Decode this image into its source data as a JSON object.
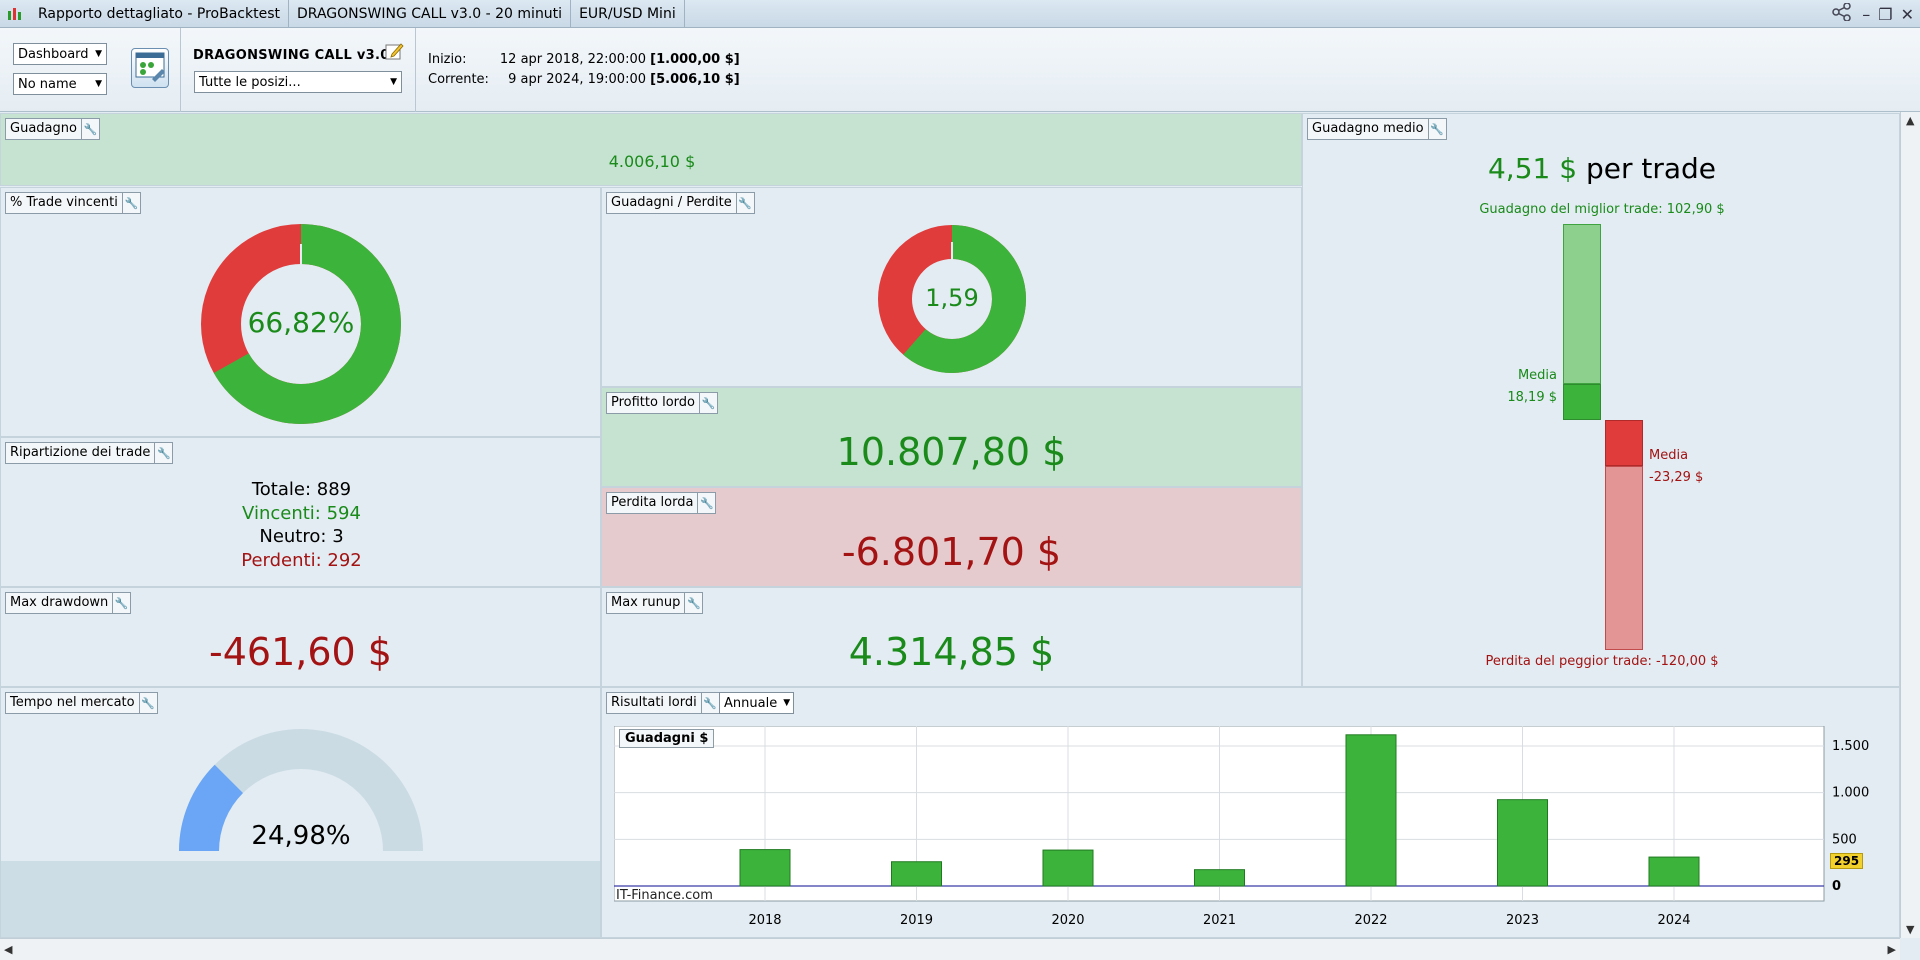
{
  "titlebar": {
    "tabs": [
      "Rapporto dettagliato - ProBacktest",
      "DRAGONSWING CALL v3.0 - 20 minuti",
      "EUR/USD Mini"
    ]
  },
  "toolbar": {
    "view_select": "Dashboard",
    "name_select": "No name",
    "strategy_name": "DRAGONSWING CALL v3.0",
    "positions_select": "Tutte le posizi...",
    "start_label": "Inizio:",
    "start_date": "12 apr 2018, 22:00:00",
    "start_capital": "[1.000,00 $]",
    "current_label": "Corrente:",
    "current_date": "9 apr 2024, 19:00:00",
    "current_capital": "[5.006,10 $]"
  },
  "gain": {
    "title": "Guadagno",
    "value": "4.006,10 $"
  },
  "win_pct": {
    "title": "% Trade vincenti",
    "value_label": "66,82%",
    "value": 66.82
  },
  "gain_loss": {
    "title": "Guadagni / Perdite",
    "value_label": "1,59",
    "win_fraction": 0.614
  },
  "gross_profit": {
    "title": "Profitto lordo",
    "value": "10.807,80 $"
  },
  "gross_loss": {
    "title": "Perdita lorda",
    "value": "-6.801,70 $"
  },
  "breakdown": {
    "title": "Ripartizione dei trade",
    "total_label": "Totale:",
    "total": "889",
    "win_label": "Vincenti:",
    "win": "594",
    "neutral_label": "Neutro:",
    "neutral": "3",
    "loss_label": "Perdenti:",
    "loss": "292"
  },
  "max_drawdown": {
    "title": "Max drawdown",
    "value": "-461,60 $"
  },
  "max_runup": {
    "title": "Max runup",
    "value": "4.314,85 $"
  },
  "avg_gain": {
    "title": "Guadagno medio",
    "value": "4,51 $",
    "per_trade": "per trade",
    "best_trade": "Guadagno del miglior trade: 102,90 $",
    "avg_label_win": "Media",
    "avg_win": "18,19 $",
    "avg_label_loss": "Media",
    "avg_loss": "-23,29 $",
    "worst_trade": "Perdita del peggior trade: -120,00 $"
  },
  "time_in_market": {
    "title": "Tempo nel mercato",
    "value_label": "24,98%",
    "value": 24.98
  },
  "gross_results": {
    "title": "Risultati lordi",
    "period_select": "Annuale",
    "series_label": "Guadagni $",
    "watermark": "IT-Finance.com",
    "current_marker": "295"
  },
  "chart_data": {
    "type": "bar",
    "categories": [
      "2018",
      "2019",
      "2020",
      "2021",
      "2022",
      "2023",
      "2024"
    ],
    "series": [
      {
        "name": "Guadagni $",
        "values": [
          390,
          260,
          385,
          175,
          1620,
          925,
          310
        ]
      }
    ],
    "yticks": [
      "0",
      "500",
      "1.000",
      "1.500"
    ],
    "ylim": [
      0,
      1650
    ],
    "grid": true,
    "bar_color": "#3cb43c"
  }
}
